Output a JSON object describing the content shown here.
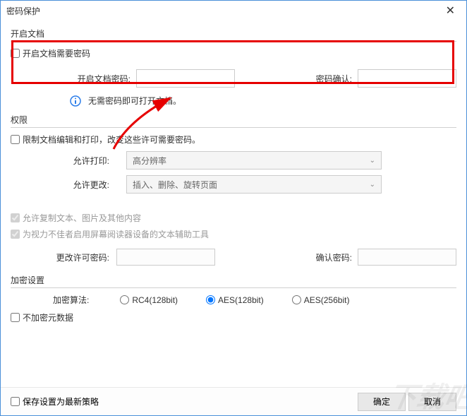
{
  "title": "密码保护",
  "section_open": {
    "title": "开启文档",
    "checkbox_label": "开启文档需要密码",
    "pwd_label": "开启文档密码:",
    "confirm_label": "密码确认:",
    "info_text": "无需密码即可打开文档。"
  },
  "section_permission": {
    "title": "权限",
    "checkbox_label": "限制文档编辑和打印，改变这些许可需要密码。",
    "allow_print_label": "允许打印:",
    "allow_print_value": "高分辨率",
    "allow_change_label": "允许更改:",
    "allow_change_value": "插入、删除、旋转页面",
    "allow_copy_label": "允许复制文本、图片及其他内容",
    "allow_reader_label": "为视力不佳者启用屏幕阅读器设备的文本辅助工具",
    "change_pwd_label": "更改许可密码:",
    "confirm_pwd_label": "确认密码:"
  },
  "section_encrypt": {
    "title": "加密设置",
    "algo_label": "加密算法:",
    "algo_options": {
      "rc4": "RC4(128bit)",
      "aes128": "AES(128bit)",
      "aes256": "AES(256bit)"
    },
    "no_meta_label": "不加密元数据"
  },
  "footer": {
    "save_policy_label": "保存设置为最新策略",
    "ok": "确定",
    "cancel": "取消"
  }
}
